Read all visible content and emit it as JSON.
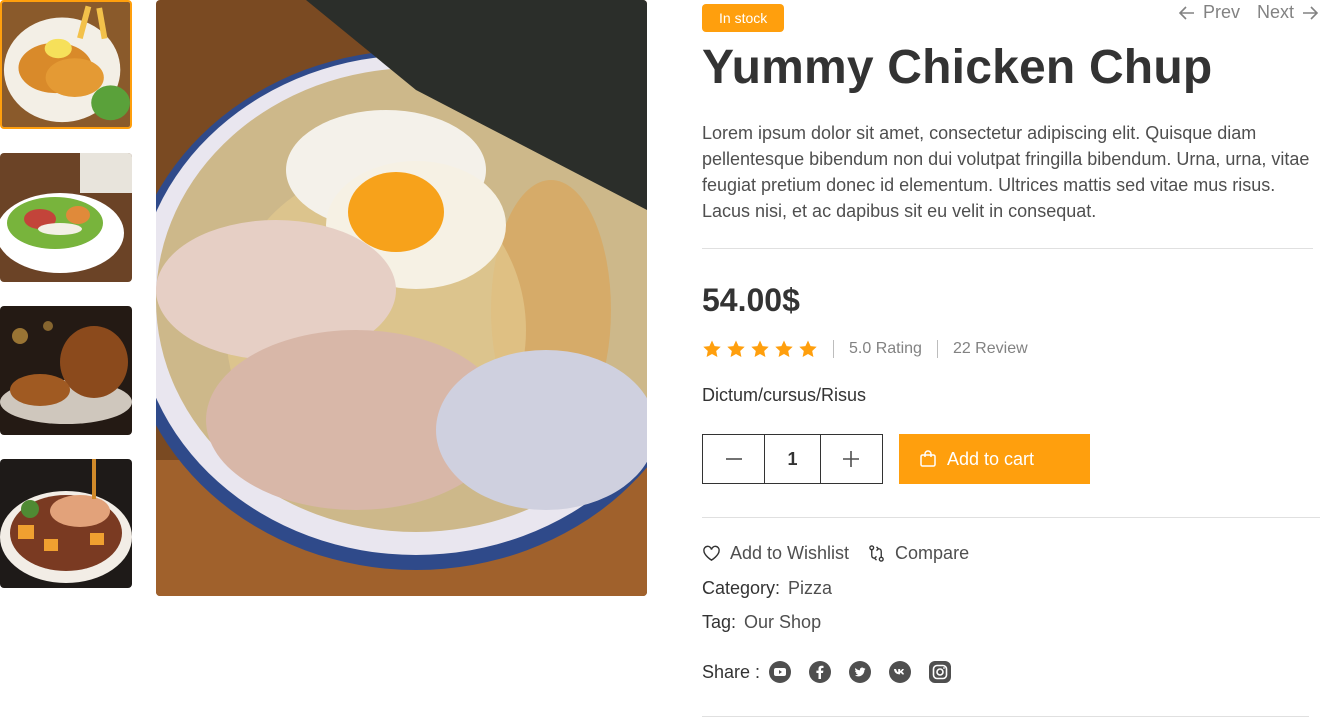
{
  "gallery": {
    "thumbnails": [
      "chicken-cutlet-thumbnail",
      "salad-thumbnail",
      "roast-chicken-thumbnail",
      "chicken-bowl-thumbnail"
    ],
    "main_image": "ramen-bowl-image"
  },
  "product": {
    "stock_badge": "In stock",
    "nav": {
      "prev": "Prev",
      "next": "Next"
    },
    "title": "Yummy Chicken Chup",
    "description": "Lorem ipsum dolor sit amet, consectetur adipiscing elit. Quisque diam pellentesque bibendum non dui volutpat fringilla bibendum. Urna, urna, vitae feugiat pretium donec id elementum. Ultrices mattis sed vitae mus risus. Lacus nisi, et ac dapibus sit eu velit in consequat.",
    "price": "54.00$",
    "stars": 5,
    "rating_text": "5.0 Rating",
    "review_text": "22 Review",
    "path": "Dictum/cursus/Risus",
    "quantity": "1",
    "add_to_cart": "Add to cart",
    "wishlist": "Add to Wishlist",
    "compare": "Compare",
    "category_label": "Category:",
    "category_value": "Pizza",
    "tag_label": "Tag:",
    "tag_value": "Our Shop",
    "share_label": "Share :",
    "social_icons": [
      "youtube-icon",
      "facebook-icon",
      "twitter-icon",
      "vk-icon",
      "instagram-icon"
    ]
  },
  "colors": {
    "accent": "#ff9f0d",
    "text_dark": "#333333",
    "text_muted": "#828282",
    "divider": "#e0e0e0"
  }
}
